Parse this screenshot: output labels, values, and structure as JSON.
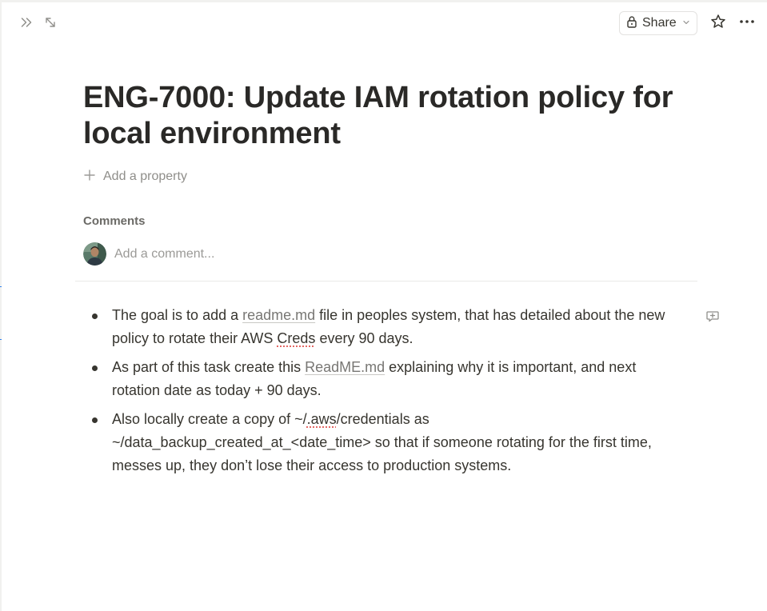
{
  "toolbar": {
    "share_label": "Share"
  },
  "page": {
    "title": "ENG-7000: Update IAM rotation policy for local environment",
    "add_property_label": "Add a property"
  },
  "comments": {
    "heading": "Comments",
    "placeholder": "Add a comment..."
  },
  "content": {
    "bullets": [
      {
        "pre": "The goal is to add a ",
        "link": "readme.md",
        "mid": " file in peoples system, that has detailed about the new policy to rotate their AWS ",
        "spell": "Creds",
        "post": " every 90 days."
      },
      {
        "pre": "As part of this task create this ",
        "link": "ReadME.md",
        "post": " explaining why it is important, and next rotation date as today + 90 days."
      },
      {
        "pre": "Also locally create a copy of ~/",
        "spell": ".aws",
        "post": "/credentials as ~/data_backup_created_at_<date_time> so that if someone rotating for the first time, messes up, they don’t lose their access to production systems."
      }
    ]
  },
  "icons": {
    "sidebar_toggle": "double-chevron-right-icon",
    "expand": "diagonal-arrows-icon",
    "lock": "lock-icon",
    "chevron": "chevron-down-icon",
    "favorite": "star-icon",
    "more": "more-horizontal-icon",
    "add": "plus-icon",
    "comment": "comment-icon"
  }
}
